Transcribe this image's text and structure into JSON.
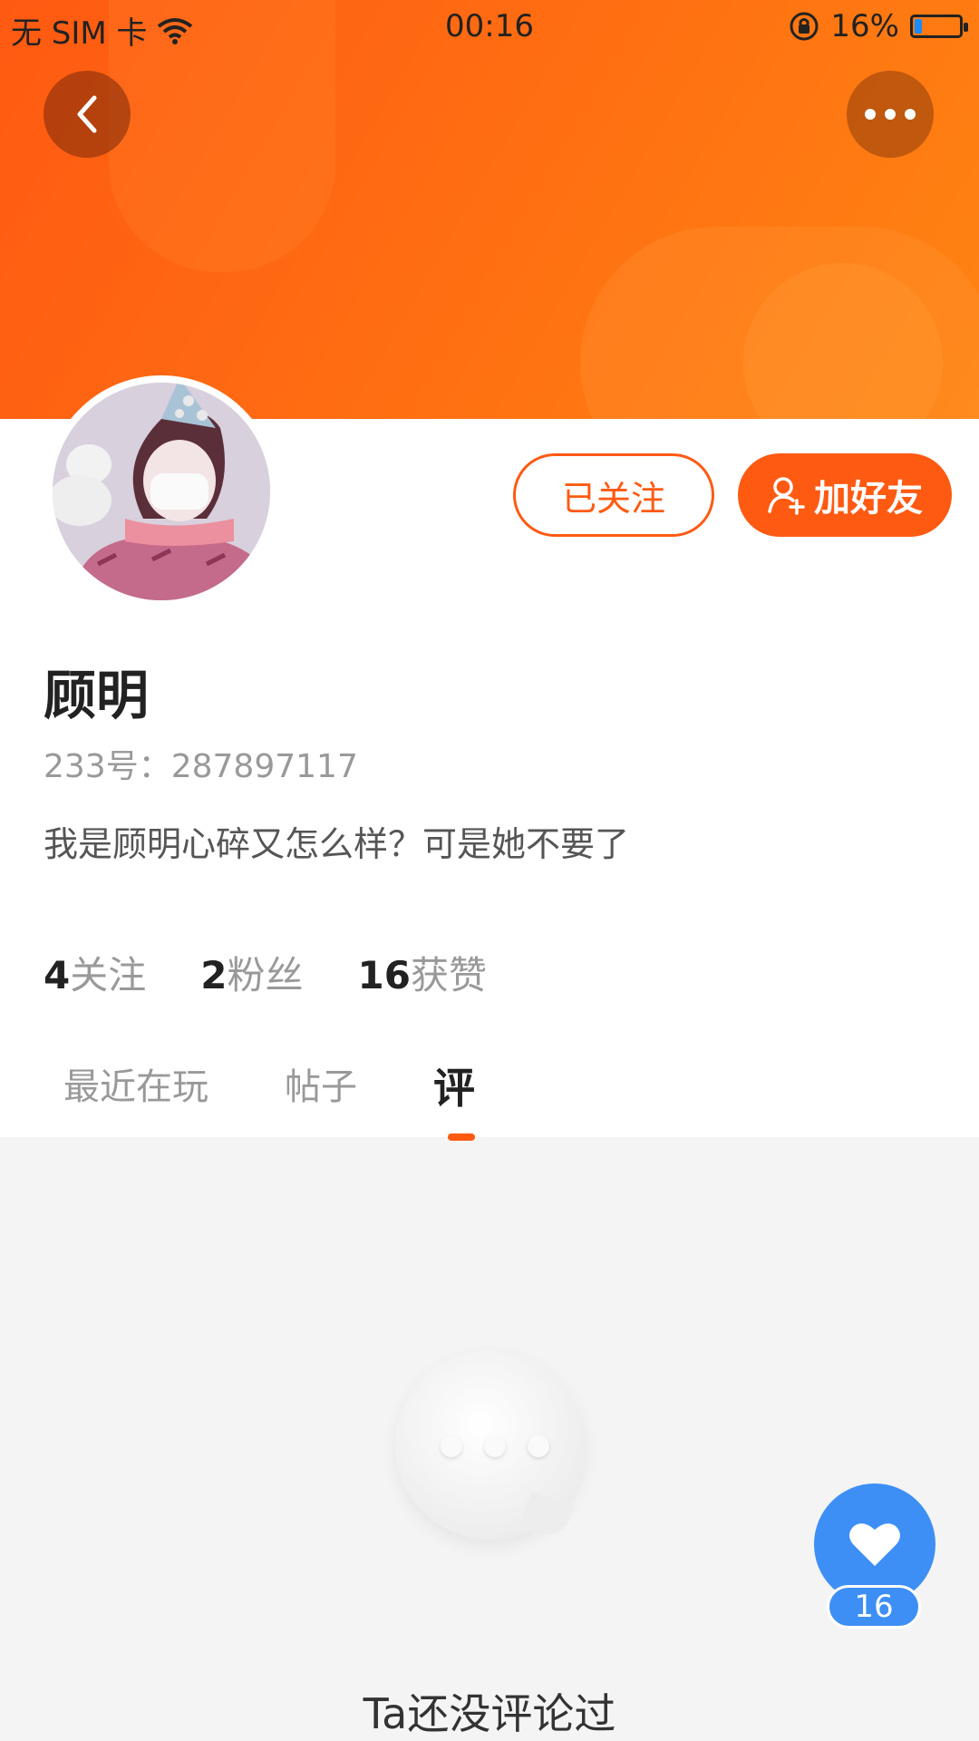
{
  "status_bar": {
    "carrier": "无 SIM 卡",
    "time": "00:16",
    "battery_text": "16%",
    "battery_level": 0.16
  },
  "header": {
    "back_icon": "chevron-left-icon",
    "more_icon": "more-horizontal-icon"
  },
  "profile": {
    "follow_button": "已关注",
    "add_friend_button": "加好友",
    "name": "顾明",
    "uid": "233号：287897117",
    "bio": "我是顾明心碎又怎么样？可是她不要了"
  },
  "stats": [
    {
      "num": "4",
      "label": "关注"
    },
    {
      "num": "2",
      "label": "粉丝"
    },
    {
      "num": "16",
      "label": "获赞"
    }
  ],
  "tabs": [
    "最近在玩",
    "帖子",
    "评"
  ],
  "empty": {
    "text": "Ta还没评论过"
  },
  "like": {
    "count": "16"
  },
  "colors": {
    "accent": "#ff5a12",
    "like_blue": "#3d8ff5"
  }
}
